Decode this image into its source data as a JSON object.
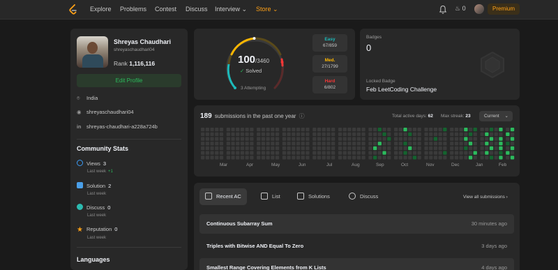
{
  "nav": {
    "items": [
      "Explore",
      "Problems",
      "Contest",
      "Discuss",
      "Interview",
      "Store"
    ],
    "streak_count": "0",
    "premium_label": "Premium",
    "icons": [
      "leetcode-logo-icon",
      "bell-icon",
      "fire-icon",
      "avatar"
    ]
  },
  "profile": {
    "name": "Shreyas Chaudhari",
    "username": "shreyaschaudhari04",
    "rank_label": "Rank",
    "rank_value": "1,116,116",
    "edit_label": "Edit Profile",
    "location": "India",
    "github": "shreyaschaudhari04",
    "linkedin": "shreyas-chaudhari-a228a724b"
  },
  "community": {
    "title": "Community Stats",
    "stats": [
      {
        "label": "Views",
        "value": "3",
        "sub": "Last week",
        "delta": "+1",
        "color": "#3b9cf6"
      },
      {
        "label": "Solution",
        "value": "2",
        "sub": "Last week",
        "delta": "",
        "color": "#4a9fe8"
      },
      {
        "label": "Discuss",
        "value": "0",
        "sub": "Last week",
        "delta": "",
        "color": "#2cbbb0"
      },
      {
        "label": "Reputation",
        "value": "0",
        "sub": "Last week",
        "delta": "",
        "color": "#ffa116"
      }
    ]
  },
  "languages_title": "Languages",
  "solved": {
    "count": "100",
    "total": "/3460",
    "label": "Solved",
    "attempting": "3 Attempting",
    "difficulties": [
      {
        "label": "Easy",
        "value": "67/859",
        "color": "#1cbaba"
      },
      {
        "label": "Med.",
        "value": "27/1799",
        "color": "#ffb700"
      },
      {
        "label": "Hard",
        "value": "6/802",
        "color": "#f63737"
      }
    ]
  },
  "badges": {
    "label": "Badges",
    "count": "0",
    "locked_label": "Locked Badge",
    "locked_name": "Feb LeetCoding Challenge"
  },
  "calendar": {
    "count": "189",
    "title": "submissions in the past one year",
    "active_days_label": "Total active days:",
    "active_days": "62",
    "max_streak_label": "Max streak:",
    "max_streak": "23",
    "select": "Current",
    "months": [
      "Mar",
      "Apr",
      "May",
      "Jun",
      "Jul",
      "Aug",
      "Sep",
      "Oct",
      "Nov",
      "Dec",
      "Jan",
      "Feb"
    ]
  },
  "recent": {
    "tabs": [
      "Recent AC",
      "List",
      "Solutions",
      "Discuss"
    ],
    "view_all": "View all submissions",
    "submissions": [
      {
        "title": "Continuous Subarray Sum",
        "time": "30 minutes ago"
      },
      {
        "title": "Triples with Bitwise AND Equal To Zero",
        "time": "3 days ago"
      },
      {
        "title": "Smallest Range Covering Elements from K Lists",
        "time": "4 days ago"
      }
    ]
  }
}
